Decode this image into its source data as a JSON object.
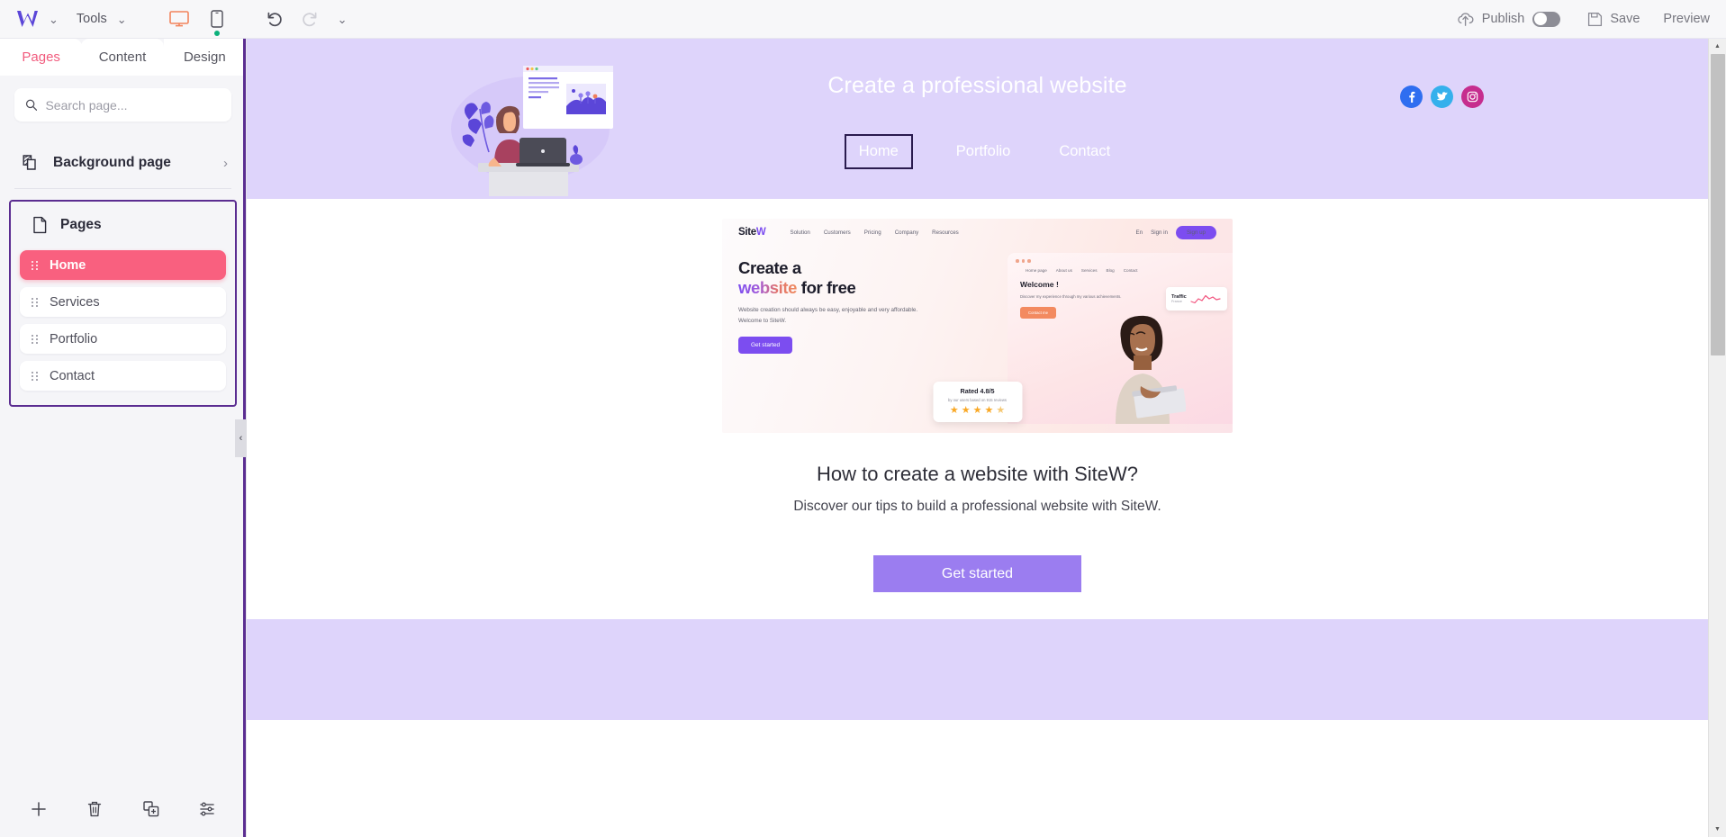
{
  "topbar": {
    "logo": "w-logo",
    "logo_caret": "⌄",
    "tools_label": "Tools",
    "tools_caret": "⌄",
    "desktop_icon": "desktop-monitor-icon",
    "mobile_icon": "mobile-phone-icon",
    "undo_icon": "undo-arrow-icon",
    "redo_icon": "redo-arrow-icon",
    "history_caret": "⌄",
    "publish_label": "Publish",
    "publish_toggle_state": "off",
    "save_label": "Save",
    "preview_label": "Preview",
    "accent_orange": "#f2845c",
    "accent_green": "#0bb07b",
    "logo_purple": "#5b46d8"
  },
  "sidebar": {
    "tabs": [
      {
        "label": "Pages",
        "active": true
      },
      {
        "label": "Content",
        "active": false
      },
      {
        "label": "Design",
        "active": false
      }
    ],
    "search": {
      "placeholder": "Search page...",
      "value": "",
      "icon": "search-icon"
    },
    "background_page": {
      "label": "Background page",
      "icon": "layers-icon",
      "chevron": "›"
    },
    "pages_section": {
      "label": "Pages",
      "icon": "page-document-icon",
      "highlight_color": "#5b2d91",
      "items": [
        {
          "label": "Home",
          "active": true
        },
        {
          "label": "Services",
          "active": false
        },
        {
          "label": "Portfolio",
          "active": false
        },
        {
          "label": "Contact",
          "active": false
        }
      ],
      "active_color": "#f9607f"
    },
    "footer_buttons": [
      {
        "name": "add-page-button",
        "icon": "plus-icon"
      },
      {
        "name": "delete-page-button",
        "icon": "trash-icon"
      },
      {
        "name": "duplicate-page-button",
        "icon": "duplicate-icon"
      },
      {
        "name": "page-settings-button",
        "icon": "sliders-icon"
      }
    ],
    "collapse_handle": "‹"
  },
  "canvas": {
    "hero": {
      "background": "#ded4fb",
      "title": "Create a professional website",
      "nav": [
        {
          "label": "Home",
          "selected": true
        },
        {
          "label": "Portfolio",
          "selected": false
        },
        {
          "label": "Contact",
          "selected": false
        }
      ],
      "socials": [
        {
          "name": "facebook-icon",
          "glyph": "f",
          "color": "#2f6ef0"
        },
        {
          "name": "twitter-icon",
          "glyph": "t",
          "color": "#35b0ec"
        },
        {
          "name": "instagram-icon",
          "glyph": "i",
          "color": "#c62d8e"
        }
      ],
      "illustration": "woman-at-desk-with-laptop-illustration"
    },
    "embed": {
      "logo_prefix": "Site",
      "logo_suffix": "W",
      "nav_items": [
        "Solution",
        "Customers",
        "Pricing",
        "Company",
        "Resources"
      ],
      "lang": "En",
      "signin": "Sign in",
      "signup": "Sign up",
      "headline_line1": "Create a",
      "headline_highlight": "website",
      "headline_rest": " for free",
      "paragraph": "Website creation should always be easy, enjoyable and very affordable. Welcome to SiteW.",
      "button": "Get started",
      "mini_nav": [
        "Home page",
        "About us",
        "Services",
        "Blog",
        "Contact"
      ],
      "mini_welcome_title": "Welcome !",
      "mini_welcome_text": "Discover my experience through my various achievements.",
      "mini_welcome_button": "Contact me",
      "traffic_title": "Traffic",
      "traffic_sub": "France",
      "rating_title": "Rated 4.8/5",
      "rating_sub": "by our users based on 915 reviews",
      "rating_stars": 5,
      "rating_value": 4.8
    },
    "section_title": "How to create a website with SiteW?",
    "section_subtitle": "Discover our tips to build a professional website with SiteW.",
    "cta_label": "Get started",
    "cta_color": "#9b7df0",
    "footer_band_color": "#ded4fb"
  },
  "scrollbar": {
    "up_arrow": "▲",
    "down_arrow": "▼"
  }
}
